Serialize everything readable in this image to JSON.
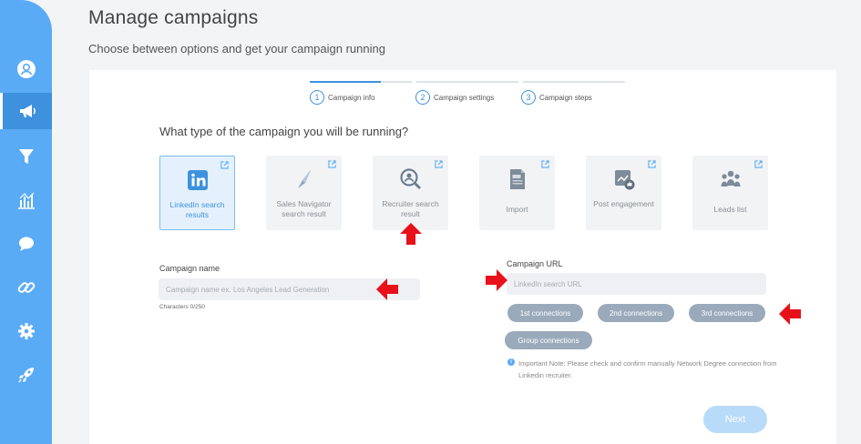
{
  "header": {
    "title": "Manage campaigns",
    "subtitle": "Choose between options and get your campaign running"
  },
  "sidebar": {
    "items": [
      {
        "icon": "user-icon",
        "active": false
      },
      {
        "icon": "megaphone-icon",
        "active": true
      },
      {
        "icon": "filter-icon",
        "active": false
      },
      {
        "icon": "analytics-icon",
        "active": false
      },
      {
        "icon": "chat-icon",
        "active": false
      },
      {
        "icon": "link-icon",
        "active": false
      },
      {
        "icon": "gear-icon",
        "active": false
      },
      {
        "icon": "rocket-icon",
        "active": false
      }
    ]
  },
  "steps": [
    {
      "number": "1",
      "label": "Campaign info",
      "progress": 0.7
    },
    {
      "number": "2",
      "label": "Campaign settings",
      "progress": 0
    },
    {
      "number": "3",
      "label": "Campaign steps",
      "progress": 0
    }
  ],
  "question": "What type of the campaign you will be running?",
  "campaign_types": [
    {
      "label": "LinkedIn search results",
      "icon": "linkedin-icon",
      "selected": true
    },
    {
      "label": "Sales Navigator search result",
      "icon": "compass-icon",
      "selected": false
    },
    {
      "label": "Recruiter search result",
      "icon": "recruiter-search-icon",
      "selected": false
    },
    {
      "label": "Import",
      "icon": "csv-file-icon",
      "selected": false
    },
    {
      "label": "Post engagement",
      "icon": "post-engagement-icon",
      "selected": false
    },
    {
      "label": "Leads list",
      "icon": "group-icon",
      "selected": false
    }
  ],
  "campaign_name": {
    "label": "Campaign name",
    "placeholder": "Campaign name ex. Los Angeles Lead Generation",
    "value": "",
    "counter": "Characters 0/250"
  },
  "campaign_url": {
    "label": "Campaign URL",
    "placeholder": "LinkedIn search URL",
    "value": ""
  },
  "connections": {
    "first": "1st connections",
    "second": "2nd connections",
    "third": "3rd connections",
    "group": "Group connections"
  },
  "note": "Important Note: Please check and confirm manually Network Degree connection from Linkedin recruiter.",
  "next_label": "Next",
  "colors": {
    "sidebar": "#5aabf5",
    "accent": "#3e91dd",
    "arrow": "#e8101a",
    "chip": "#9aaabb"
  }
}
